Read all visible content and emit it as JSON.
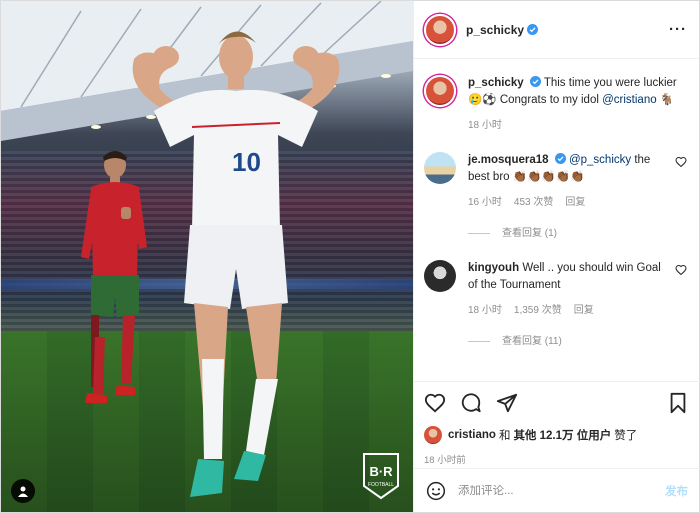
{
  "post": {
    "username": "p_schicky",
    "verified": true,
    "caption": {
      "text": "This time you were luckier 🥲⚽️ Congrats to my idol",
      "mention": "@cristiano",
      "emoji_end": "🐐"
    },
    "caption_time": "18 小时",
    "more_icon": "···"
  },
  "comments": [
    {
      "username": "je.mosquera18",
      "verified": true,
      "mention": "@p_schicky",
      "text": "the best bro 👏🏾👏🏾👏🏾👏🏾👏🏾",
      "time": "16 小时",
      "likes": "453 次赞",
      "reply": "回复",
      "view_replies": "查看回复 (1)"
    },
    {
      "username": "kingyouh",
      "verified": false,
      "mention": "",
      "text": "Well .. you should win Goal of the Tournament",
      "time": "18 小时",
      "likes": "1,359 次赞",
      "reply": "回复",
      "view_replies": "查看回复 (11)"
    }
  ],
  "likes_line": {
    "user": "cristiano",
    "middle": "和",
    "others": "其他 12.1万 位用户",
    "suffix": "赞了"
  },
  "post_time": "18 小时前",
  "comment_box": {
    "placeholder": "添加评论...",
    "post_label": "发布"
  },
  "photo": {
    "jersey_number": "10",
    "logo_text": "B·R",
    "logo_sub": "FOOTBALL"
  },
  "icons": [
    "heart-icon",
    "comment-icon",
    "share-icon",
    "bookmark-icon",
    "emoji-icon",
    "verified-icon",
    "user-tag-icon"
  ],
  "colors": {
    "verified": "#3897f0",
    "link": "#00376b",
    "muted": "#8e8e8e",
    "post_disabled": "#b2dffc"
  }
}
